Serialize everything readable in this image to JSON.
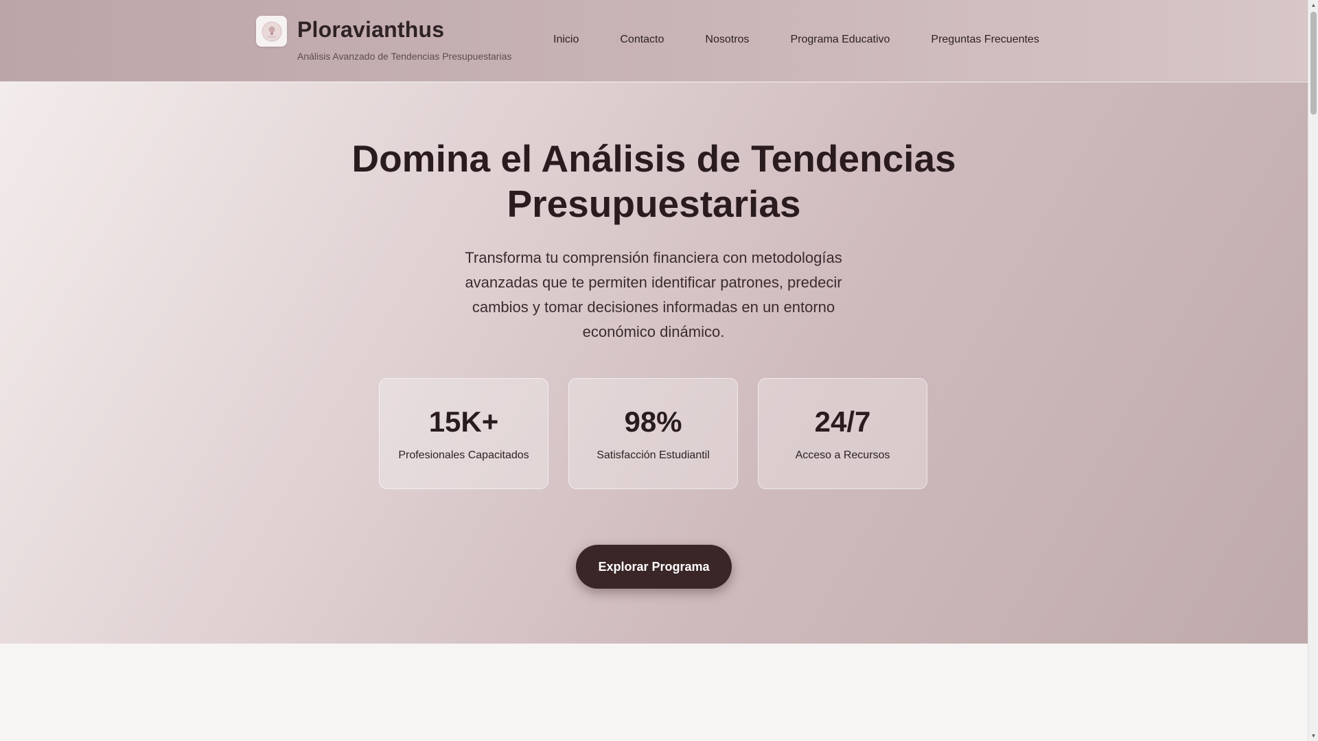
{
  "header": {
    "brand_name": "Ploravianthus",
    "tagline": "Análisis Avanzado de Tendencias Presupuestarias",
    "logo_icon": "lightbulb-icon",
    "nav": [
      {
        "label": "Inicio"
      },
      {
        "label": "Contacto"
      },
      {
        "label": "Nosotros"
      },
      {
        "label": "Programa Educativo"
      },
      {
        "label": "Preguntas Frecuentes"
      }
    ]
  },
  "hero": {
    "title_line1": "Domina el Análisis de Tendencias",
    "title_line2": "Presupuestarias",
    "description": "Transforma tu comprensión financiera con metodologías avanzadas que te permiten identificar patrones, predecir cambios y tomar decisiones informadas en un entorno económico dinámico.",
    "stats": [
      {
        "value": "15K+",
        "label": "Profesionales Capacitados"
      },
      {
        "value": "98%",
        "label": "Satisfacción Estudiantil"
      },
      {
        "value": "24/7",
        "label": "Acceso a Recursos"
      }
    ],
    "cta_label": "Explorar Programa"
  },
  "colors": {
    "header_bg": "#c8b3b5",
    "text_dark": "#2a1c1e",
    "cta_bg": "#3a2527",
    "lower_bg": "#f6f5f3"
  }
}
